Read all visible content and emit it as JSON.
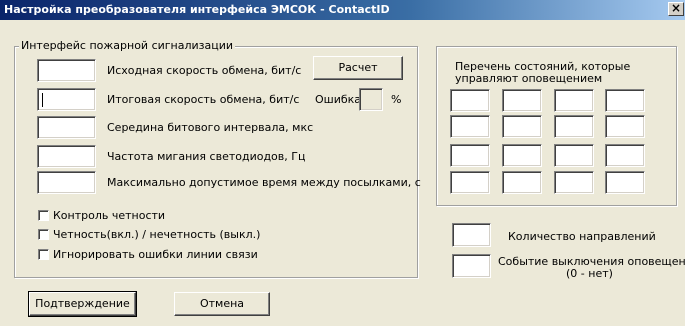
{
  "window": {
    "title": "Настройка преобразователя интерфейса ЭМСОК - ContactID",
    "close_glyph": "×"
  },
  "left_group": {
    "legend": "Интерфейс пожарной сигнализации",
    "fields": [
      {
        "label": "Исходная скорость обмена, бит/с",
        "value": ""
      },
      {
        "label": "Итоговая скорость обмена, бит/с",
        "value": ""
      },
      {
        "label": "Середина битового интервала, мкс",
        "value": ""
      },
      {
        "label": "Частота мигания светодиодов, Гц",
        "value": ""
      },
      {
        "label": "Максимально допустимое время между посылками, с",
        "value": ""
      }
    ],
    "calc_button": "Расчет",
    "error_label": "Ошибка",
    "error_value": "",
    "error_unit": "%",
    "checkboxes": [
      {
        "label": "Контроль четности",
        "checked": false
      },
      {
        "label": "Четность(вкл.) / нечетность (выкл.)",
        "checked": false
      },
      {
        "label": "Игнорировать ошибки линии связи",
        "checked": false
      }
    ]
  },
  "right_group": {
    "title_line1": "Перечень состояний, которые",
    "title_line2": "управляют оповещением",
    "grid_values": [
      "",
      "",
      "",
      "",
      "",
      "",
      "",
      "",
      "",
      "",
      "",
      "",
      "",
      "",
      "",
      ""
    ]
  },
  "directions": {
    "label": "Количество направлений",
    "value": ""
  },
  "off_event": {
    "label_line1": "Событие выключения оповещения",
    "label_line2": "(0 - нет)",
    "value": ""
  },
  "buttons": {
    "confirm": "Подтверждение",
    "cancel": "Отмена"
  }
}
